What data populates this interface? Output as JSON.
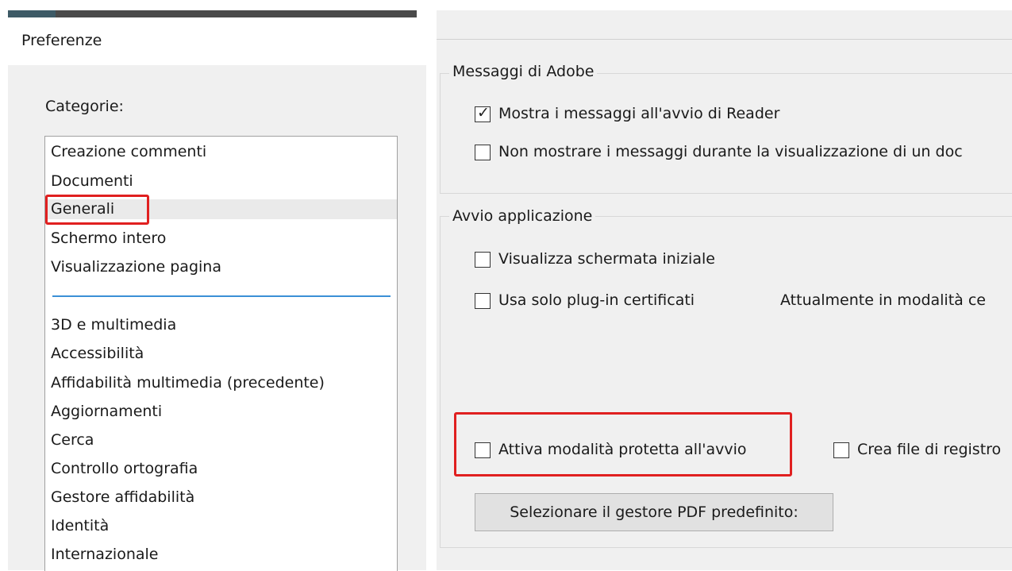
{
  "dialog": {
    "title": "Preferenze"
  },
  "categories": {
    "label": "Categorie:",
    "group1": [
      "Creazione commenti",
      "Documenti",
      "Generali",
      "Schermo intero",
      "Visualizzazione pagina"
    ],
    "group2": [
      "3D e multimedia",
      "Accessibilità",
      "Affidabilità multimedia (precedente)",
      "Aggiornamenti",
      "Cerca",
      "Controllo ortografia",
      "Gestore affidabilità",
      "Identità",
      "Internazionale"
    ],
    "selected": "Generali"
  },
  "adobe_messages": {
    "title": "Messaggi di Adobe",
    "show_on_startup": {
      "label": "Mostra i messaggi all'avvio di Reader",
      "checked": true
    },
    "dont_show_while_viewing": {
      "label": "Non mostrare i messaggi durante la visualizzazione di un doc",
      "checked": false
    }
  },
  "app_startup": {
    "title": "Avvio applicazione",
    "show_splash": {
      "label": "Visualizza schermata iniziale",
      "checked": false
    },
    "certified_plugins": {
      "label": "Usa solo plug-in certificati",
      "checked": false
    },
    "certified_status": "Attualmente in modalità ce",
    "protected_mode": {
      "label": "Attiva modalità protetta all'avvio",
      "checked": false
    },
    "log_file": {
      "label": "Crea file di registro",
      "checked": false
    },
    "default_pdf_handler_button": "Selezionare il gestore PDF predefinito:"
  },
  "colors": {
    "highlight": "#e02020",
    "list_separator": "#3b8fd6",
    "panel_bg": "#f0f0f0"
  }
}
